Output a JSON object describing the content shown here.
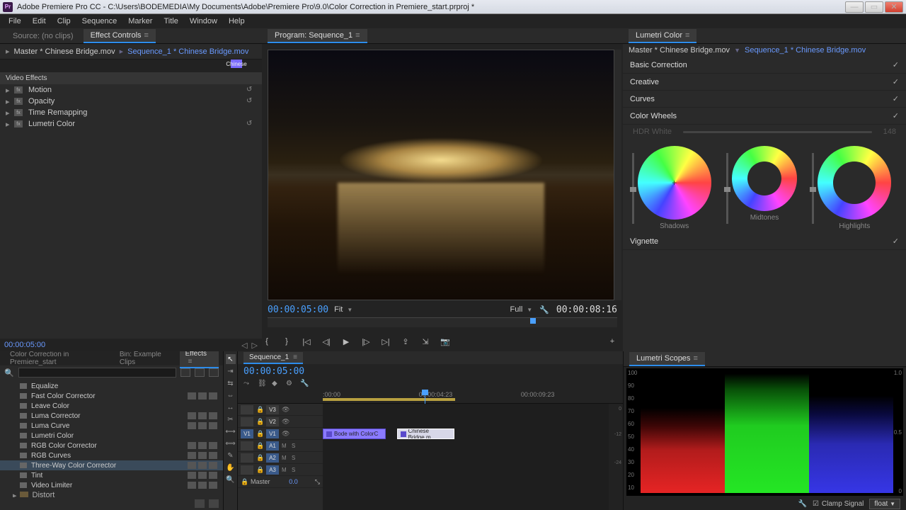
{
  "titlebar": {
    "app_icon": "Pr",
    "title": "Adobe Premiere Pro CC - C:\\Users\\BODEMEDIA\\My Documents\\Adobe\\Premiere Pro\\9.0\\Color Correction in Premiere_start.prproj *"
  },
  "menu": [
    "File",
    "Edit",
    "Clip",
    "Sequence",
    "Marker",
    "Title",
    "Window",
    "Help"
  ],
  "effect_controls": {
    "tab_source": "Source: (no clips)",
    "tab_active": "Effect Controls",
    "master": "Master * Chinese Bridge.mov",
    "sequence": "Sequence_1 * Chinese Bridge.mov",
    "marker_label": "Chinese",
    "section": "Video Effects",
    "effects": [
      "Motion",
      "Opacity",
      "Time Remapping",
      "Lumetri Color"
    ],
    "timecode": "00:00:05:00"
  },
  "program": {
    "tab": "Program: Sequence_1",
    "tc_left": "00:00:05:00",
    "fit": "Fit",
    "full": "Full",
    "tc_right": "00:00:08:16"
  },
  "lumetri": {
    "tab": "Lumetri Color",
    "master": "Master * Chinese Bridge.mov",
    "sequence": "Sequence_1 * Chinese Bridge.mov",
    "sections": {
      "basic": "Basic Correction",
      "creative": "Creative",
      "curves": "Curves",
      "wheels": "Color Wheels",
      "vignette": "Vignette"
    },
    "hdr_white": "HDR White",
    "hdr_value": "148",
    "wheel_labels": {
      "shadows": "Shadows",
      "midtones": "Midtones",
      "highlights": "Highlights"
    }
  },
  "effects_browser": {
    "tabs": {
      "project": "Color Correction in Premiere_start",
      "bin": "Bin: Example Clips",
      "effects": "Effects"
    },
    "items": [
      {
        "name": "Equalize",
        "badges": 0
      },
      {
        "name": "Fast Color Corrector",
        "badges": 3
      },
      {
        "name": "Leave Color",
        "badges": 0
      },
      {
        "name": "Luma Corrector",
        "badges": 3
      },
      {
        "name": "Luma Curve",
        "badges": 3
      },
      {
        "name": "Lumetri Color",
        "badges": 0
      },
      {
        "name": "RGB Color Corrector",
        "badges": 3
      },
      {
        "name": "RGB Curves",
        "badges": 3
      },
      {
        "name": "Three-Way Color Corrector",
        "badges": 3,
        "selected": true
      },
      {
        "name": "Tint",
        "badges": 3
      },
      {
        "name": "Video Limiter",
        "badges": 3
      }
    ],
    "folder": "Distort"
  },
  "timeline": {
    "tab": "Sequence_1",
    "tc": "00:00:05:00",
    "ruler": [
      ":00:00",
      "00:00:04:23",
      "00:00:09:23"
    ],
    "video_tracks": [
      "V3",
      "V2",
      "V1"
    ],
    "audio_tracks": [
      "A1",
      "A2",
      "A3"
    ],
    "src_label": "V1",
    "master": "Master",
    "master_val": "0.0",
    "clip1": "Bode with ColorC",
    "clip2": "Chinese Bridge.m",
    "mute": "M",
    "solo": "S"
  },
  "scopes": {
    "tab": "Lumetri Scopes",
    "y_ticks": [
      "100",
      "90",
      "80",
      "70",
      "60",
      "50",
      "40",
      "30",
      "20",
      "10"
    ],
    "r_ticks": [
      "1.0",
      "0.5",
      "0"
    ],
    "clamp": "Clamp Signal",
    "mode": "float"
  }
}
